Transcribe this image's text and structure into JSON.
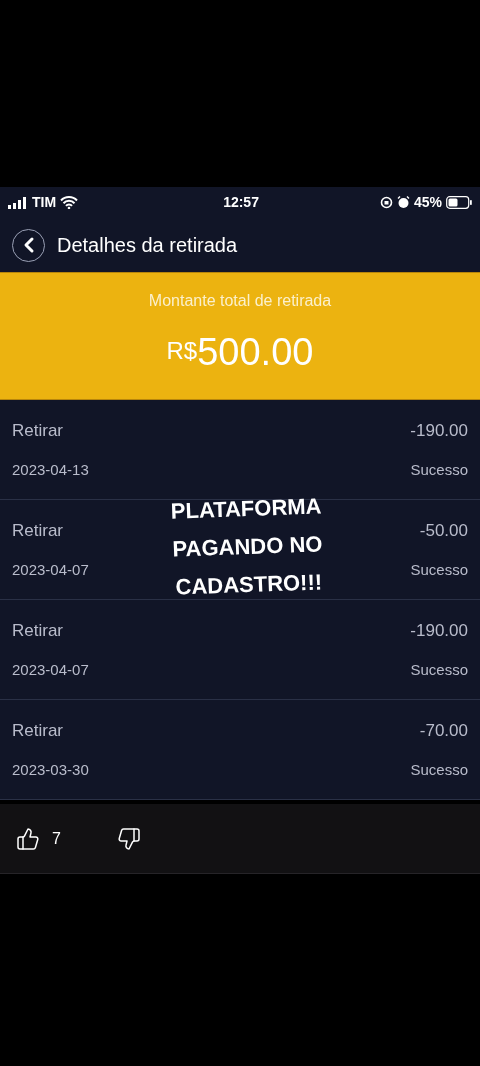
{
  "status_bar": {
    "carrier": "TIM",
    "time": "12:57",
    "battery": "45%"
  },
  "header": {
    "title": "Detalhes da retirada"
  },
  "summary": {
    "label": "Montante total de retirada",
    "currency": "R$",
    "amount": "500.00"
  },
  "transactions": [
    {
      "type": "Retirar",
      "amount": "-190.00",
      "date": "2023-04-13",
      "status": "Sucesso"
    },
    {
      "type": "Retirar",
      "amount": "-50.00",
      "date": "2023-04-07",
      "status": "Sucesso"
    },
    {
      "type": "Retirar",
      "amount": "-190.00",
      "date": "2023-04-07",
      "status": "Sucesso"
    },
    {
      "type": "Retirar",
      "amount": "-70.00",
      "date": "2023-03-30",
      "status": "Sucesso"
    }
  ],
  "caption": [
    "PLATAFORMA",
    "PAGANDO NO",
    "CADASTRO!!!"
  ],
  "reactions": {
    "likes": "7"
  }
}
